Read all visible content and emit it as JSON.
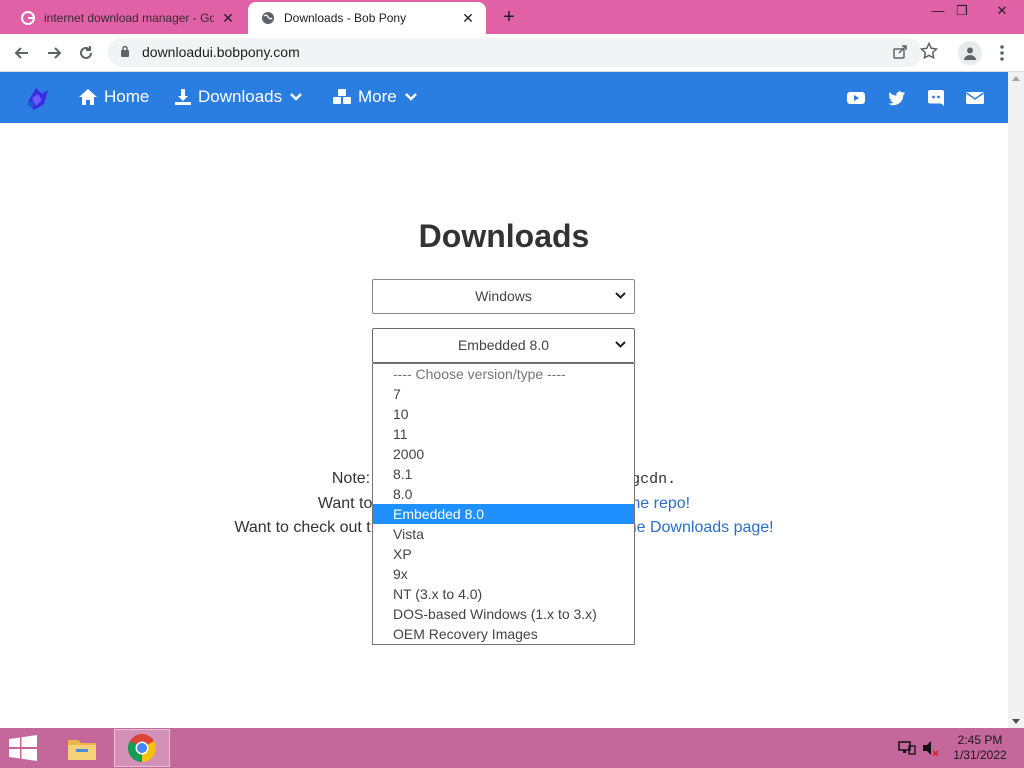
{
  "browser": {
    "tabs": [
      {
        "title": "internet download manager - Go",
        "active": false,
        "icon": "google-icon"
      },
      {
        "title": "Downloads - Bob Pony",
        "active": true,
        "icon": "globe-icon"
      }
    ],
    "new_tab": "+",
    "url": "downloadui.bobpony.com",
    "colors": {
      "tabstrip": "#e061a5",
      "toolbar": "#ffffff"
    }
  },
  "site_nav": {
    "links": [
      {
        "label": "Home",
        "icon": "home-icon"
      },
      {
        "label": "Downloads",
        "icon": "download-icon",
        "has_dropdown": true
      },
      {
        "label": "More",
        "icon": "cubes-icon",
        "has_dropdown": true
      }
    ],
    "social": [
      "youtube-icon",
      "twitter-icon",
      "discord-icon",
      "mail-icon"
    ],
    "color": "#2a7de1"
  },
  "page": {
    "title": "Downloads",
    "os_select": {
      "value": "Windows"
    },
    "version_select": {
      "value": "Embedded 8.0",
      "options": [
        "---- Choose version/type ----",
        "7",
        "10",
        "11",
        "2000",
        "8.1",
        "8.0",
        "Embedded 8.0",
        "Vista",
        "XP",
        "9x",
        "NT (3.x to 4.0)",
        "DOS-based Windows (1.x to 3.x)",
        "OEM Recovery Images"
      ],
      "selected_index": 7
    },
    "notes": {
      "line1_prefix": "Note: l",
      "line1_suffix": "igcdn.",
      "line2_prefix": "Want to",
      "line2_link": "he repo!",
      "line3_prefix": "Want to check out t",
      "line3_link": "he Downloads page!"
    }
  },
  "taskbar": {
    "time": "2:45 PM",
    "date": "1/31/2022",
    "color": "#c4679b"
  }
}
